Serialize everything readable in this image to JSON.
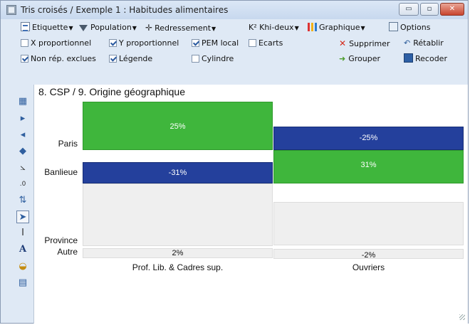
{
  "window": {
    "title": "Tris croisés / Exemple 1 : Habitudes alimentaires",
    "controls": {
      "minimize": "▭",
      "maximize": "▫",
      "close": "✕"
    }
  },
  "toolbar1": {
    "etiquette": "Etiquette",
    "population": "Population",
    "redressement": "Redressement",
    "khideux": "K² Khi-deux",
    "graphique": "Graphique",
    "options": "Options"
  },
  "toolbar2": {
    "x_prop": {
      "label": "X proportionnel",
      "checked": false
    },
    "y_prop": {
      "label": "Y proportionnel",
      "checked": true
    },
    "pem": {
      "label": "PEM local",
      "checked": true
    },
    "ecarts": {
      "label": "Ecarts",
      "checked": false
    },
    "supprimer": "Supprimer",
    "retablir": "Rétablir"
  },
  "toolbar3": {
    "non_rep": {
      "label": "Non rép. exclues",
      "checked": true
    },
    "legende": {
      "label": "Légende",
      "checked": true
    },
    "cylindre": {
      "label": "Cylindre",
      "checked": false
    },
    "grouper": "Grouper",
    "recoder": "Recoder"
  },
  "side_tools": [
    "table-icon",
    "arrow-right-icon",
    "arrow-left-icon",
    "arrow-both-icon",
    "axis-icon",
    "decimals-icon",
    "sort-icon",
    "pointer-icon",
    "text-cursor-icon",
    "font-icon",
    "fill-icon",
    "window-icon"
  ],
  "chart": {
    "title": "8. CSP / 9. Origine géographique",
    "rows": [
      "Paris",
      "Banlieue",
      "Province",
      "Autre"
    ],
    "columns": [
      "Prof. Lib. & Cadres sup.",
      "Ouvriers"
    ],
    "cells": {
      "c0_paris": "25%",
      "c0_banlieue": "-31%",
      "c0_autre": "2%",
      "c1_paris": "-25%",
      "c1_banlieue": "31%",
      "c1_autre": "-2%"
    },
    "colors": {
      "positive": "#3fb63c",
      "negative": "#24409c",
      "neutral": "#efefef"
    }
  }
}
